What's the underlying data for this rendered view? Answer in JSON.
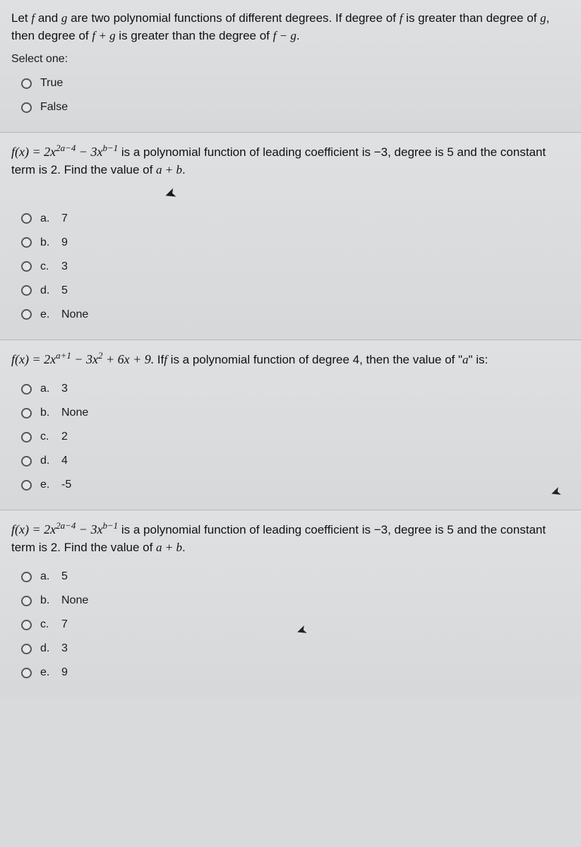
{
  "q1": {
    "text_parts": {
      "p1": "Let ",
      "f": "f",
      "p2": " and ",
      "g": "g",
      "p3": " are two polynomial functions of different degrees. If degree of ",
      "f2": "f",
      "p4": " is greater than degree of ",
      "g2": "g",
      "p5": ", then degree of ",
      "sum": "f + g",
      "p6": " is greater than the degree of ",
      "diff": "f − g",
      "p7": "."
    },
    "prompt": "Select one:",
    "options": [
      {
        "text": "True"
      },
      {
        "text": "False"
      }
    ]
  },
  "q2": {
    "formula": {
      "lhs": "f(x) = 2x",
      "exp1": "2a−4",
      "mid": " − 3x",
      "exp2": "b−1"
    },
    "tail": " is a polynomial function of leading coefficient is −3,  degree is 5 and the constant term is 2. Find the value of ",
    "ab": "a + b",
    "period": ".",
    "options": [
      {
        "letter": "a.",
        "text": "7"
      },
      {
        "letter": "b.",
        "text": "9"
      },
      {
        "letter": "c.",
        "text": "3"
      },
      {
        "letter": "d.",
        "text": "5"
      },
      {
        "letter": "e.",
        "text": "None"
      }
    ]
  },
  "q3": {
    "formula": {
      "lhs": "f(x) = 2x",
      "exp1": "a+1",
      "mid1": " − 3x",
      "exp2": "2",
      "mid2": " + 6x + 9. "
    },
    "tail_pre": "If",
    "tail_f": "f",
    "tail_post": " is a polynomial function of degree 4, then the value of  \"",
    "a": "a",
    "tail_end": "\" is:",
    "options": [
      {
        "letter": "a.",
        "text": "3"
      },
      {
        "letter": "b.",
        "text": "None"
      },
      {
        "letter": "c.",
        "text": "2"
      },
      {
        "letter": "d.",
        "text": "4"
      },
      {
        "letter": "e.",
        "text": "-5"
      }
    ]
  },
  "q4": {
    "formula": {
      "lhs": "f(x) = 2x",
      "exp1": "2a−4",
      "mid": " − 3x",
      "exp2": "b−1"
    },
    "tail": " is a polynomial function of leading coefficient is −3,  degree is 5 and the constant term is 2. Find the value of ",
    "ab": "a + b",
    "period": ".",
    "options": [
      {
        "letter": "a.",
        "text": "5"
      },
      {
        "letter": "b.",
        "text": "None"
      },
      {
        "letter": "c.",
        "text": "7"
      },
      {
        "letter": "d.",
        "text": "3"
      },
      {
        "letter": "e.",
        "text": "9"
      }
    ]
  },
  "cursor_glyph": "↖"
}
